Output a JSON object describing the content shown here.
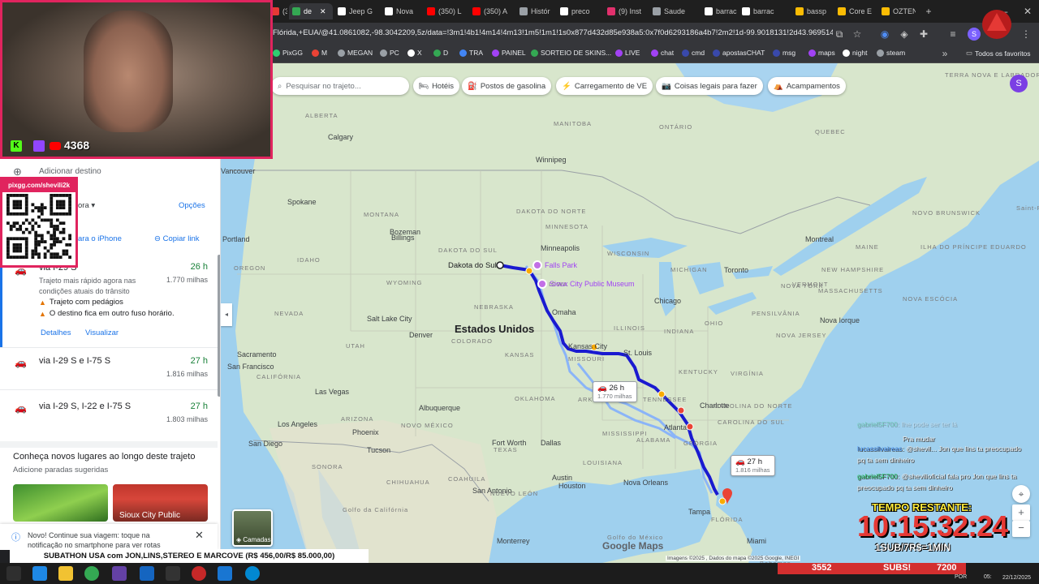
{
  "browser": {
    "tabs": [
      {
        "label": "(30) F",
        "color": "#e53935"
      },
      {
        "label": "de",
        "color": "#34a853",
        "active": true
      },
      {
        "label": "Jeep G",
        "color": "#ffffff"
      },
      {
        "label": "Nova",
        "color": "#ffffff"
      },
      {
        "label": "(350) L",
        "color": "#ff0000"
      },
      {
        "label": "(350) A",
        "color": "#ff0000"
      },
      {
        "label": "Histór",
        "color": "#9aa0a6"
      },
      {
        "label": "preco",
        "color": "#ffffff"
      },
      {
        "label": "(9) Inst",
        "color": "#e1306c"
      },
      {
        "label": "Saude",
        "color": "#9aa0a6"
      },
      {
        "label": "barrac",
        "color": "#ffffff"
      },
      {
        "label": "barrac",
        "color": "#ffffff"
      },
      {
        "label": "bassp",
        "color": "#fbbc04"
      },
      {
        "label": "Core E",
        "color": "#fbbc04"
      },
      {
        "label": "OZTEN",
        "color": "#fbbc04"
      }
    ],
    "url": "Flórida,+EUA/@41.0861082,-98.3042209,5z/data=!3m1!4b1!4m14!4m13!1m5!1m1!1s0x877d432d85e938a5:0x7f0d6293186a4b7!2m2!1d-99.9018131!2d43.9695148!1...",
    "bookmarks": [
      {
        "label": "PixGG",
        "color": "#2ecc71"
      },
      {
        "label": "M",
        "color": "#ea4335"
      },
      {
        "label": "MEGAN",
        "color": "#9aa0a6"
      },
      {
        "label": "PC",
        "color": "#9aa0a6"
      },
      {
        "label": "X",
        "color": "#ffffff"
      },
      {
        "label": "D",
        "color": "#34a853"
      },
      {
        "label": "TRA",
        "color": "#4285f4"
      },
      {
        "label": "PAINEL",
        "color": "#a142f4"
      },
      {
        "label": "SORTEIO DE SKINS...",
        "color": "#34a853"
      },
      {
        "label": "LIVE",
        "color": "#a142f4"
      },
      {
        "label": "chat",
        "color": "#a142f4"
      },
      {
        "label": "cmd",
        "color": "#3949ab"
      },
      {
        "label": "apostasCHAT",
        "color": "#3949ab"
      },
      {
        "label": "msg",
        "color": "#3949ab"
      },
      {
        "label": "maps",
        "color": "#a142f4"
      },
      {
        "label": "night",
        "color": "#ffffff"
      },
      {
        "label": "steam",
        "color": "#9aa0a6"
      }
    ],
    "all_bookmarks": "Todos os favoritos"
  },
  "webcam": {
    "viewer_count": "4368"
  },
  "qr": {
    "title": "pixgg.com/shevili2k"
  },
  "leftpanel": {
    "add_destination": "Adicionar destino",
    "depart_partial": "ora",
    "options": "Opções",
    "send_phone_partial": "ara o iPhone",
    "copy_link": "Copiar link",
    "routes": [
      {
        "via_partial": "via I-29 S",
        "time": "26 h",
        "dist": "1.770 milhas",
        "desc": "Trajeto mais rápido agora nas condições atuais do trânsito",
        "warnings": [
          "Trajeto com pedágios",
          "O destino fica em outro fuso horário."
        ],
        "details": "Detalhes",
        "view": "Visualizar"
      },
      {
        "via": "via I-29 S e I-75 S",
        "time": "27 h",
        "dist": "1.816 milhas"
      },
      {
        "via": "via I-29 S, I-22 e I-75 S",
        "time": "27 h",
        "dist": "1.803 milhas"
      }
    ],
    "explore_title": "Conheça novos lugares ao longo deste trajeto",
    "explore_sub": "Adicione paradas sugeridas",
    "card2_label": "Sioux City Public",
    "notice": "Novo! Continue sua viagem: toque na notificação no smartphone para ver rotas"
  },
  "map": {
    "search_placeholder": "Pesquisar no trajeto...",
    "chips": [
      "Hotéis",
      "Postos de gasolina",
      "Carregamento de VE",
      "Coisas legais para fazer",
      "Acampamentos"
    ],
    "avatar_letter": "S",
    "country_label": "Estados Unidos",
    "origin_label": "Dakota do Sul",
    "pois": [
      "Falls Park",
      "Sioux City Public Museum"
    ],
    "cities": [
      "Calgary",
      "Winnipeg",
      "Vancouver",
      "Spokane",
      "Portland",
      "Minneapolis",
      "Toronto",
      "Montreal",
      "Chicago",
      "Omaha",
      "Kansas City",
      "St. Louis",
      "Denver",
      "Salt Lake City",
      "Sacramento",
      "San Francisco",
      "Las Vegas",
      "Los Angeles",
      "San Diego",
      "Phoenix",
      "Tucson",
      "Albuquerque",
      "Fort Worth",
      "Dallas",
      "Austin",
      "San Antonio",
      "Houston",
      "Nova Orleans",
      "Atlanta",
      "Charlotte",
      "Tampa",
      "Miami",
      "Nova Iorque",
      "Monterrey",
      "Billings",
      "Bozeman"
    ],
    "states": [
      "ALBERTA",
      "MANITOBA",
      "ONTÁRIO",
      "QUEBEC",
      "TERRA NOVA E LABRADOR",
      "MONTANA",
      "DAKOTA DO NORTE",
      "MINNESOTA",
      "WISCONSIN",
      "MICHIGAN",
      "IDAHO",
      "OREGON",
      "WYOMING",
      "IOWA",
      "NEBRASKA",
      "ILLINOIS",
      "INDIANA",
      "OHIO",
      "PENSILVÂNIA",
      "NOVA YORK",
      "NEVADA",
      "UTAH",
      "COLORADO",
      "KANSAS",
      "MISSOURI",
      "KENTUCKY",
      "VIRGÍNIA",
      "CALIFÓRNIA",
      "ARIZONA",
      "NOVO MÉXICO",
      "OKLAHOMA",
      "ARKANSAS",
      "TENNESSEE",
      "CAROLINA DO NORTE",
      "CAROLINA DO SUL",
      "TEXAS",
      "MISSISSIPPI",
      "ALABAMA",
      "GEÓRGIA",
      "FLÓRIDA",
      "LOUISIANA",
      "NOVO BRUNSWICK",
      "MAINE",
      "NEW HAMPSHIRE",
      "VERMONT",
      "MASSACHUSETTS",
      "NOVA JERSEY",
      "DAKOTA DO SUL",
      "NOVA ESCÓCIA",
      "ILHA DO PRÍNCIPE EDUARDO",
      "Saint-Pierre e Miquelon",
      "Bahamas",
      "CHIHUAHUA",
      "SONORA",
      "COAHUILA",
      "NUEVO LEÓN",
      "Golfo do México",
      "Golfo da Califórnia"
    ],
    "bubble1": {
      "time": "26 h",
      "dist": "1.770 milhas"
    },
    "bubble2": {
      "time": "27 h",
      "dist": "1.816 milhas"
    },
    "layers": "Camadas",
    "logo": "Google Maps",
    "attribution": "Imagens ©2025 , Dados do mapa ©2025 Google, INEGI",
    "route_color": "#1a1ad0"
  },
  "stream": {
    "subathon": "SUBATHON USA com JON,LINS,STEREO E MARCOVE (R$ 456,00/R$ 85.000,00)",
    "tempo_label": "TEMPO RESTANTE:",
    "timer": "10:15:32:24",
    "rate": "1SUB/7R$=1MIN",
    "subs_left": "3552",
    "subs_label": "SUBS!",
    "subs_right": "7200",
    "chat": [
      {
        "user": "gabriel5F700",
        "text": "Ihe pode ser ter lá"
      },
      {
        "user": "lucasslivani",
        "text": "Pra mudar"
      },
      {
        "user": "lucassilvaireas",
        "text": "@shevil... Jon que lins ta preocupado pq ta sem dinheiro"
      },
      {
        "user": "gabriel5F700",
        "text": "@shevilioficial fala pro Jon que lins ta preocupado pq ta sem dinheiro"
      }
    ]
  },
  "taskbar": {
    "lang": "POR",
    "time": "05:",
    "date": "22/12/2025"
  }
}
